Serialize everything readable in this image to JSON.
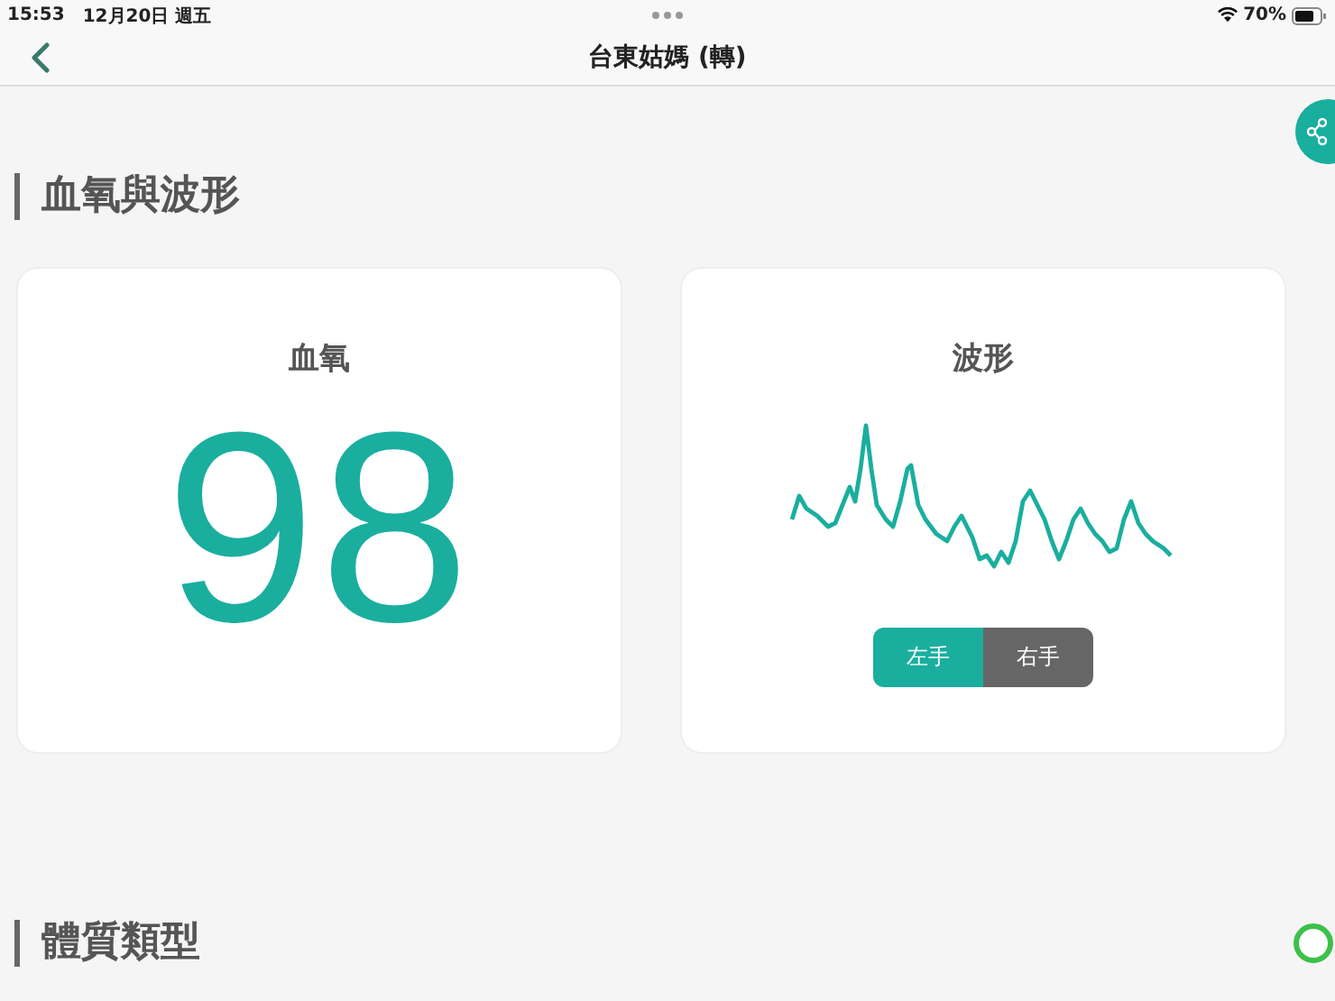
{
  "status_bar": {
    "time": "15:53",
    "date": "12月20日 週五",
    "battery": "70%"
  },
  "nav": {
    "title": "台東姑媽 (轉)"
  },
  "section_title": "血氧與波形",
  "spo2_card": {
    "title": "血氧",
    "value": "98"
  },
  "waveform_card": {
    "title": "波形",
    "hands": [
      {
        "label": "左手",
        "selected": true
      },
      {
        "label": "右手",
        "selected": false
      }
    ]
  },
  "next_section_title": "體質類型"
}
